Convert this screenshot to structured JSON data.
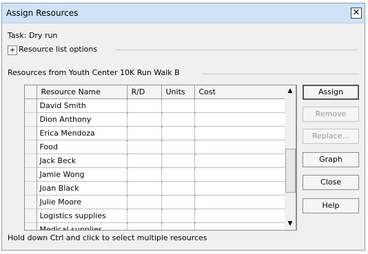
{
  "dialog": {
    "title": "Assign Resources",
    "close_glyph": "✕"
  },
  "task": {
    "text": "Task: Dry run"
  },
  "options": {
    "toggle": "+",
    "label": "Resource list options"
  },
  "resources": {
    "label": "Resources from Youth Center 10K Run Walk B"
  },
  "table": {
    "headers": {
      "name": "Resource Name",
      "rd": "R/D",
      "units": "Units",
      "cost": "Cost"
    },
    "rows": [
      {
        "name": "David Smith"
      },
      {
        "name": "Dion Anthony"
      },
      {
        "name": "Erica Mendoza"
      },
      {
        "name": "Food"
      },
      {
        "name": "Jack Beck"
      },
      {
        "name": "Jamie Wong"
      },
      {
        "name": "Joan Black"
      },
      {
        "name": "Julie Moore"
      },
      {
        "name": "Logistics supplies"
      },
      {
        "name": "Medical supplies"
      }
    ]
  },
  "scrollbar": {
    "up": "▲",
    "down": "▼"
  },
  "buttons": {
    "assign": "Assign",
    "remove": "Remove",
    "replace": "Replace...",
    "graph": "Graph",
    "close": "Close",
    "help": "Help"
  },
  "footer": {
    "hint": "Hold down Ctrl and click to select multiple resources"
  }
}
